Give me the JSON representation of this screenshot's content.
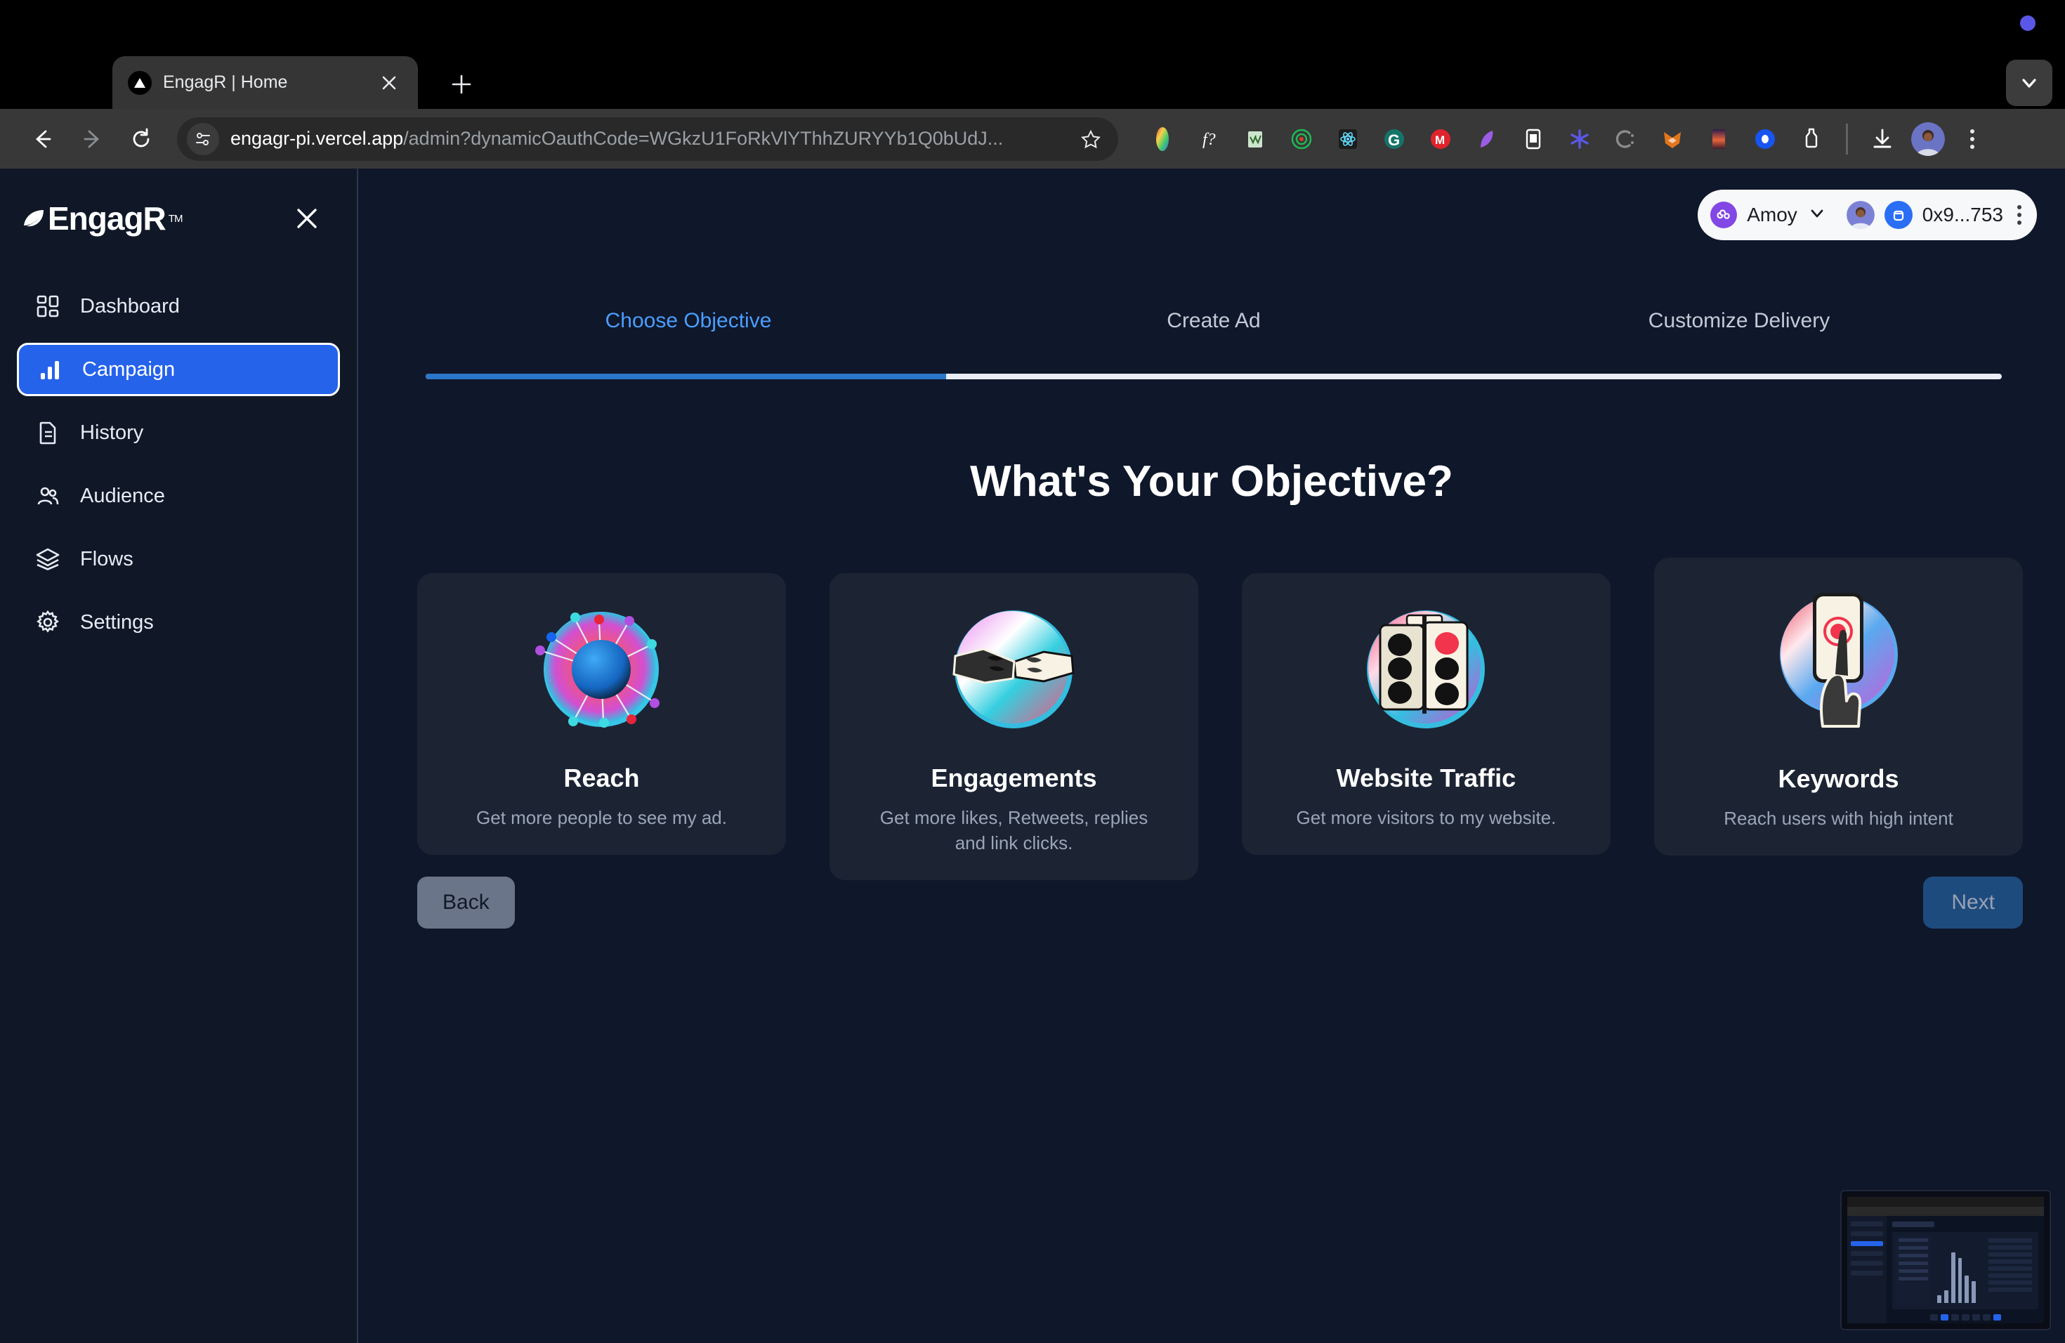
{
  "browser": {
    "tab": {
      "title": "EngagR | Home",
      "favicon_icon": "triangle-favicon",
      "close_icon": "close-icon"
    },
    "new_tab_label": "+",
    "collapse_icon": "chevron-down-icon",
    "nav": {
      "back_icon": "back-arrow-icon",
      "forward_icon": "forward-arrow-icon",
      "reload_icon": "reload-icon"
    },
    "omnibox": {
      "site_settings_icon": "tune-icon",
      "url_host": "engagr-pi.vercel.app",
      "url_path": "/admin?dynamicOauthCode=WGkzU1FoRkVlYThhZURYYb1Q0bUdJ...",
      "bookmark_icon": "star-icon"
    },
    "extensions": [
      "color-wheel-extension-icon",
      "function-extension-icon",
      "grammar-check-extension-icon",
      "target-extension-icon",
      "react-devtools-extension-icon",
      "grammarly-extension-icon",
      "mail-extension-icon",
      "feather-extension-icon",
      "reader-extension-icon",
      "asterisk-extension-icon",
      "c-extension-icon",
      "metamask-extension-icon",
      "sunset-extension-icon",
      "blue-circle-extension-icon",
      "bottle-extension-icon"
    ],
    "downloads_icon": "download-icon",
    "profile_icon": "profile-avatar",
    "menu_icon": "kebab-menu-icon",
    "notification_dot": "blue-status-dot"
  },
  "sidebar": {
    "brand": "EngagR",
    "brand_mark_icon": "leaf-logo-icon",
    "brand_tm": "TM",
    "close_icon": "close-icon",
    "items": [
      {
        "label": "Dashboard",
        "icon": "grid-dashboard-icon",
        "active": false
      },
      {
        "label": "Campaign",
        "icon": "bar-chart-icon",
        "active": true
      },
      {
        "label": "History",
        "icon": "document-icon",
        "active": false
      },
      {
        "label": "Audience",
        "icon": "users-icon",
        "active": false
      },
      {
        "label": "Flows",
        "icon": "layers-icon",
        "active": false
      },
      {
        "label": "Settings",
        "icon": "gear-icon",
        "active": false
      }
    ]
  },
  "account": {
    "network_icon": "polygon-network-icon",
    "network": "Amoy",
    "chevron_icon": "chevron-down-icon",
    "avatar_icon": "user-avatar",
    "wallet_icon": "wallet-icon",
    "address": "0x9...753",
    "menu_icon": "kebab-menu-icon"
  },
  "wizard": {
    "tabs": [
      {
        "label": "Choose Objective",
        "active": true
      },
      {
        "label": "Create Ad",
        "active": false
      },
      {
        "label": "Customize Delivery",
        "active": false
      }
    ],
    "progress_percent": 33,
    "title": "What's Your Objective?",
    "objectives": [
      {
        "title": "Reach",
        "description": "Get more people to see my ad.",
        "image_icon": "radial-burst-sphere-image"
      },
      {
        "title": "Engagements",
        "description": "Get more likes, Retweets, replies and link clicks.",
        "image_icon": "fist-bump-image"
      },
      {
        "title": "Website Traffic",
        "description": "Get more visitors to my website.",
        "image_icon": "traffic-light-image"
      },
      {
        "title": "Keywords",
        "description": "Reach users with high intent",
        "image_icon": "phone-tap-image"
      }
    ],
    "back_label": "Back",
    "next_label": "Next"
  },
  "pip": {
    "label": "picture-in-picture-preview"
  },
  "colors": {
    "accent_blue": "#2563eb",
    "tab_active": "#4a9eff",
    "app_bg": "#0f172a",
    "sidebar_bg": "#101828",
    "card_bg": "#1c2434",
    "next_disabled": "#1e4b7e",
    "back_bg": "#6b7589"
  }
}
